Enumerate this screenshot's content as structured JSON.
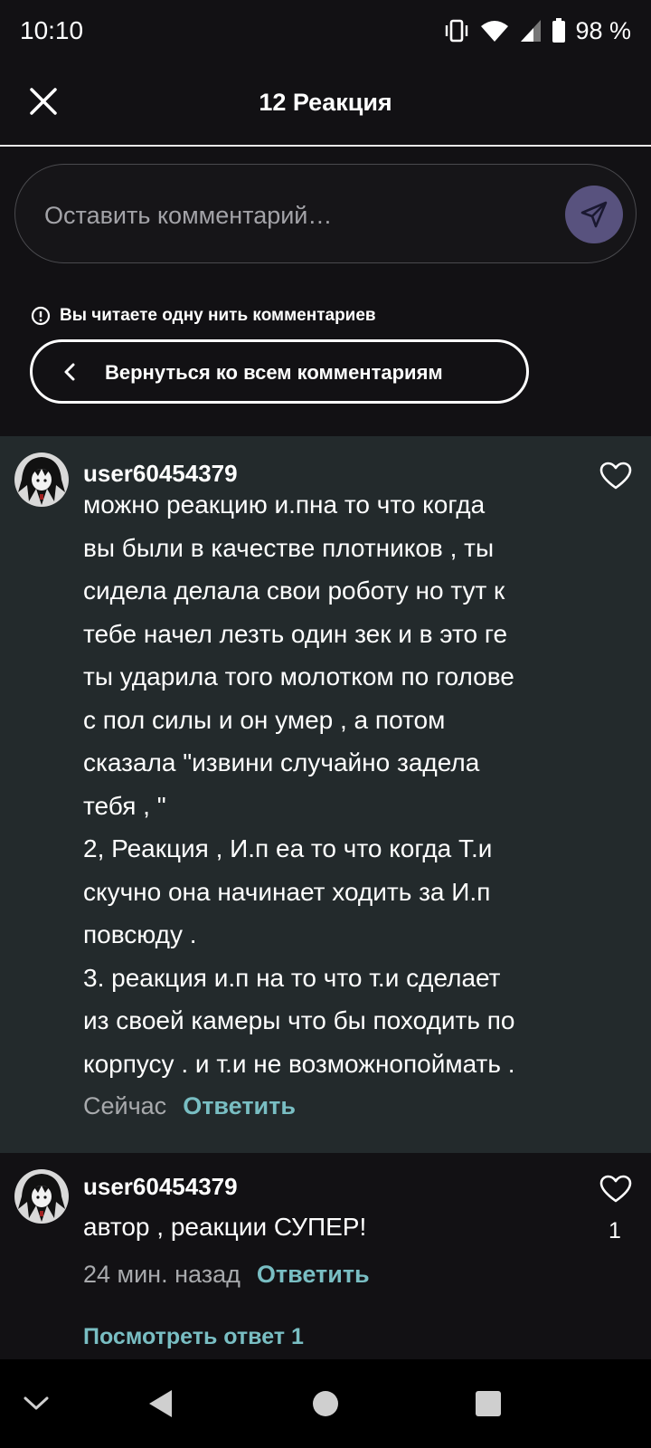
{
  "status_bar": {
    "time": "10:10",
    "battery": "98 %"
  },
  "header": {
    "title": "12 Реакция"
  },
  "comment_input": {
    "placeholder": "Оставить комментарий…"
  },
  "thread_notice": {
    "text": "Вы читаете одну нить комментариев"
  },
  "back_button": {
    "label": "Вернуться ко всем комментариям"
  },
  "comments": [
    {
      "username": "user60454379",
      "text": "можно реакцию и.пна то что когда\nвы были в качестве плотников , ты\nсидела делала свои роботу но тут к\nтебе начел лезть один зек и в это ге\nты ударила того молотком по голове\nс пол  силы  и он умер , а потом\nсказала \"извини случайно задела\nтебя , \"\n2, Реакция , И.п еа то что когда Т.и\nскучно она начинает ходить за И.п\nповсюду .\n3. реакция и.п на то что т.и сделает\nиз своей камеры что бы походить по\nкорпусу . и т.и не возможнопоймать .",
      "time": "Сейчас",
      "reply_label": "Ответить",
      "likes": ""
    },
    {
      "username": "user60454379",
      "text": "автор , реакции СУПЕР!",
      "time": "24 мин. назад",
      "reply_label": "Ответить",
      "likes": "1"
    }
  ],
  "view_replies_label": "Посмотреть ответ 1",
  "icons": {
    "close": "close-icon",
    "send": "send-icon",
    "info": "info-icon",
    "back": "chevron-left-icon",
    "like": "heart-icon"
  },
  "colors": {
    "background": "#121114",
    "highlight_background": "#232a2c",
    "accent": "#79bec3",
    "send_button": "#58527e"
  }
}
